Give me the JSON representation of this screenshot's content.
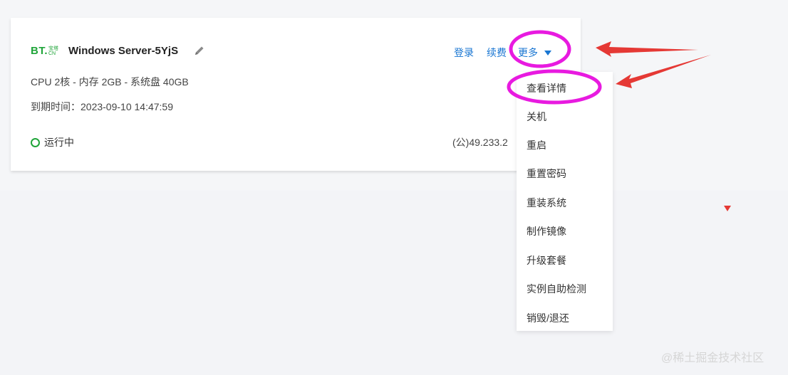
{
  "card": {
    "logo": {
      "main": "BT.",
      "sub_top": "宝塔",
      "sub_bottom": "CN"
    },
    "server_name": "Windows Server-5YjS",
    "specs": "CPU 2核 - 内存 2GB - 系统盘 40GB",
    "expire": "到期时间：2023-09-10 14:47:59",
    "status": "运行中",
    "ip": "(公)49.233.2"
  },
  "actions": {
    "login": "登录",
    "renew": "续费",
    "more": "更多"
  },
  "menu": {
    "items": [
      "查看详情",
      "关机",
      "重启",
      "重置密码",
      "重装系统",
      "制作镜像",
      "升级套餐",
      "实例自助检测",
      "销毁/退还"
    ]
  },
  "watermark": "@稀土掘金技术社区",
  "colors": {
    "brand_green": "#20a53a",
    "link_blue": "#1976d2",
    "annotation_magenta": "#e81ae0",
    "annotation_red": "#e53935"
  }
}
